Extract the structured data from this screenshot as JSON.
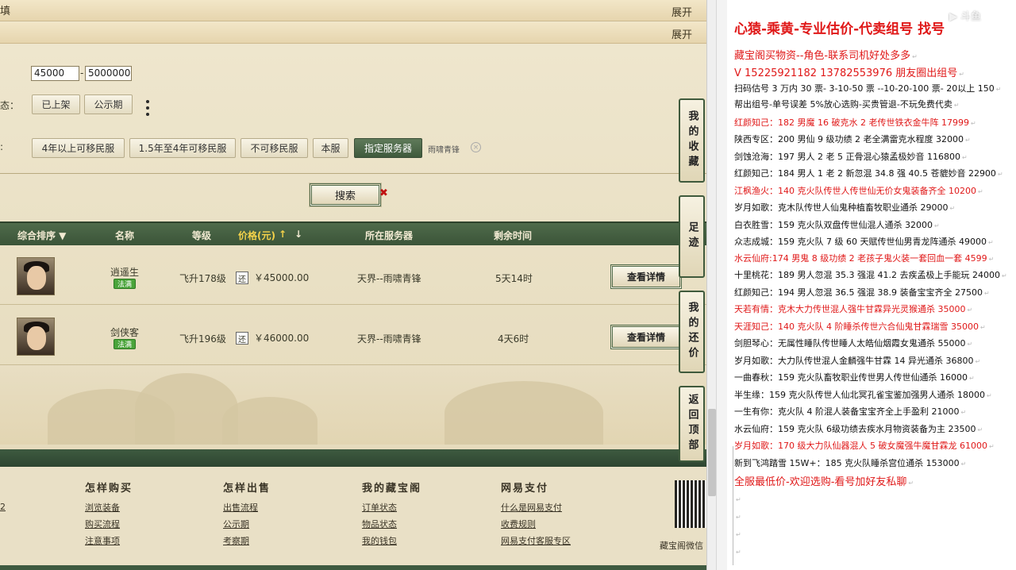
{
  "bands": [
    {
      "title": "填",
      "expand": "展开"
    },
    {
      "title": "",
      "expand": "展开"
    }
  ],
  "filters": {
    "price_min": "45000",
    "price_max": "5000000",
    "price_dash": "-",
    "status_label": "态：",
    "status_buttons": [
      "已上架",
      "公示期"
    ],
    "server_label": ":",
    "server_buttons": [
      "4年以上可移民服",
      "1.5年至4年可移民服",
      "不可移民服",
      "本服",
      "指定服务器"
    ],
    "selected_server": "雨啸青锋",
    "clear_icon": "×"
  },
  "search": {
    "label": "搜索",
    "x_mark": "✖"
  },
  "table": {
    "headers": {
      "sort": "综合排序 ▼",
      "name": "名称",
      "level": "等级",
      "price": "价格(元)",
      "server": "所在服务器",
      "time": "剩余时间"
    },
    "price_up_icon": "↑",
    "price_down_icon": "↓",
    "rows": [
      {
        "name": "逍遥生",
        "badge": "法满",
        "level": "飞升178级",
        "huan": "还",
        "price": "￥45000.00",
        "server": "天界--雨啸青锋",
        "time": "5天14时",
        "detail": "查看详情"
      },
      {
        "name": "剑侠客",
        "badge": "法满",
        "level": "飞升196级",
        "huan": "还",
        "price": "￥46000.00",
        "server": "天界--雨啸青锋",
        "time": "4天6时",
        "detail": "查看详情"
      }
    ]
  },
  "side_tabs": [
    "我的收藏",
    "足迹",
    "我的还价",
    "返回顶部"
  ],
  "footer": {
    "columns": [
      {
        "title": "怎样购买",
        "links": [
          "浏览装备",
          "购买流程",
          "注意事项"
        ]
      },
      {
        "title": "怎样出售",
        "links": [
          "出售流程",
          "公示期",
          "考察期"
        ]
      },
      {
        "title": "我的藏宝阁",
        "links": [
          "订单状态",
          "物品状态",
          "我的钱包"
        ]
      },
      {
        "title": "网易支付",
        "links": [
          "什么是网易支付",
          "收费规则",
          "网易支付客服专区"
        ]
      }
    ],
    "left_fragment": "2",
    "qr_caption": "藏宝阁微信"
  },
  "ad": {
    "title": "心猿-乘黄-专业估价-代卖组号 找号",
    "lines": [
      {
        "text": "藏宝阁买物资--角色-联系司机好处多多",
        "style": "red big"
      },
      {
        "text": "V 15225921182   13782553976 朋友圈出组号",
        "style": "red big"
      },
      {
        "text": "扫码估号 3 万内 30 票- 3-10-50 票  --10-20-100 票- 20以上 150",
        "style": ""
      },
      {
        "text": "帮出组号-单号误差 5%放心选购-买贵管退-不玩免费代卖",
        "style": ""
      },
      {
        "text": "红颜知己：182 男魔 16 破克水 2 老传世铁衣金牛阵 17999",
        "style": "red"
      },
      {
        "text": "陕西专区：200 男仙 9 级功绩 2 老全满雷克水程度 32000",
        "style": ""
      },
      {
        "text": "剑蚀沧海：197 男人 2 老 5 正骨混心猿孟极妙音 116800",
        "style": ""
      },
      {
        "text": "红颜知己：184 男人 1 老 2 新忽混 34.8 强 40.5 苍貔妙音 22900",
        "style": ""
      },
      {
        "text": "江枫渔火：140 克火队传世人传世仙无价女鬼装备齐全 10200",
        "style": "red"
      },
      {
        "text": "岁月如歌：克木队传世人仙鬼种植畜牧职业通杀 29000",
        "style": ""
      },
      {
        "text": "白衣胜雪：159 克火队双盘传世仙混人通杀 32000",
        "style": ""
      },
      {
        "text": "众志成城：159 克火队 7 级 60 天赋传世仙男青龙阵通杀 49000",
        "style": ""
      },
      {
        "text": "水云仙府:174 男鬼 8 级功绩 2 老孩子鬼火装一套回血一套 4599",
        "style": "red"
      },
      {
        "text": "十里桃花：189 男人忽混 35.3 强混 41.2 去疾孟极上手能玩 24000",
        "style": ""
      },
      {
        "text": "红颜知己：194 男人忽混 36.5 强混 38.9 装备宝宝齐全 27500",
        "style": ""
      },
      {
        "text": "天若有情：克木大力传世混人强牛甘霖异光灵猴通杀 35000",
        "style": "red"
      },
      {
        "text": "天涯知己：140 克火队 4 阶睡杀传世六合仙鬼甘霖瑞雪 35000",
        "style": "red"
      },
      {
        "text": "剑胆琴心：无属性睡队传世睡人太皓仙烟霞女鬼通杀 55000",
        "style": ""
      },
      {
        "text": "岁月如歌：大力队传世混人金麟强牛甘霖 14 异光通杀 36800",
        "style": ""
      },
      {
        "text": "一曲春秋：159 克火队畜牧职业传世男人传世仙通杀 16000",
        "style": ""
      },
      {
        "text": "半生缘：159 克火队传世人仙北冥孔雀宝鉴加强男人通杀 18000",
        "style": ""
      },
      {
        "text": "一生有你：克火队 4 阶混人装备宝宝齐全上手盈利 21000",
        "style": ""
      },
      {
        "text": "水云仙府：159 克火队 6级功绩去疾水月物资装备为主 23500",
        "style": ""
      },
      {
        "text": "岁月如歌：170 级大力队仙器混人 5 破女魔强牛魔甘霖龙 61000",
        "style": "red"
      },
      {
        "text": "新到飞鸿踏雪 15W+：185 克火队睡杀宫位通杀 153000",
        "style": ""
      },
      {
        "text": "全服最低价-欢迎选购-看号加好友私聊",
        "style": "red big"
      }
    ],
    "return_mark": "↵",
    "watermark": "▶ 斗鱼"
  },
  "colors": {
    "accent_green": "#3f5a3c",
    "ad_red": "#e01818",
    "badge_green": "#4aa43a"
  }
}
